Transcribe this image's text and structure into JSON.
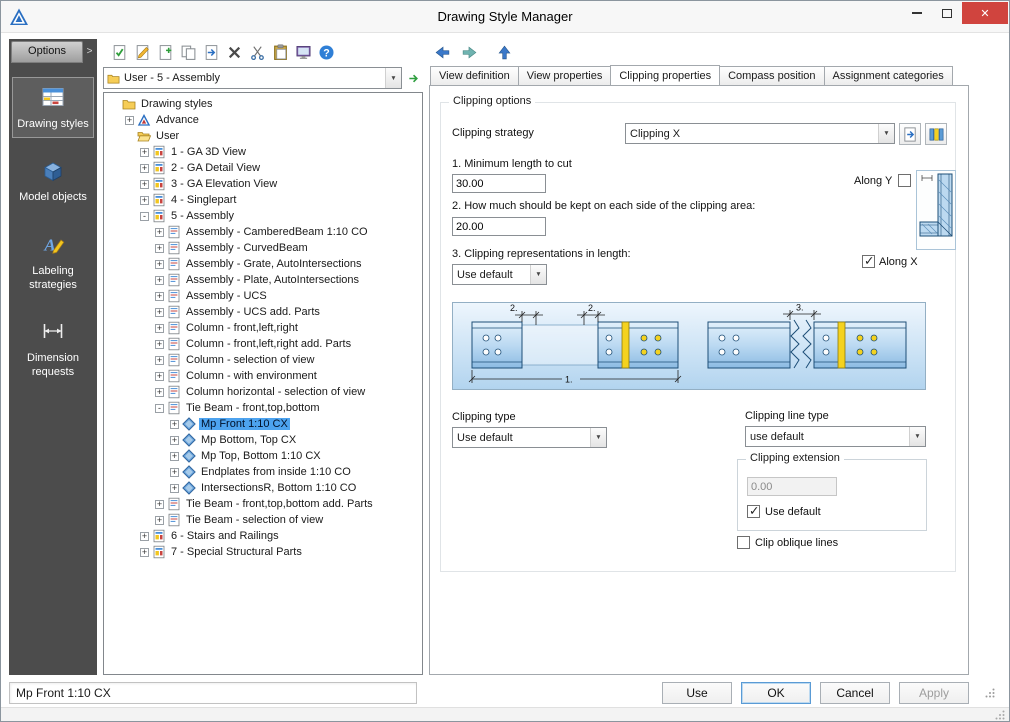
{
  "window": {
    "title": "Drawing Style Manager",
    "icons": [
      "app-logo-icon",
      "minimize-icon",
      "maximize-icon",
      "close-icon"
    ]
  },
  "sidebar": {
    "header_label": "Options",
    "collapse_glyph": ">",
    "items": [
      {
        "label": "Drawing styles",
        "icon": "drawing-styles-icon",
        "selected": true
      },
      {
        "label": "Model objects",
        "icon": "model-objects-icon",
        "selected": false
      },
      {
        "label": "Labeling strategies",
        "icon": "labeling-strategies-icon",
        "selected": false
      },
      {
        "label": "Dimension requests",
        "icon": "dimension-requests-icon",
        "selected": false
      }
    ]
  },
  "toolbar": {
    "icons": [
      "validate-style-icon",
      "edit-style-icon",
      "new-style-icon",
      "copy-style-icon",
      "import-style-icon",
      "delete-style-icon",
      "cut-style-icon",
      "paste-style-icon",
      "display-options-icon",
      "help-icon"
    ],
    "nav_icons": [
      "back-icon",
      "forward-icon",
      "up-icon"
    ]
  },
  "style_selector": {
    "value": "User - 5 - Assembly"
  },
  "tree": {
    "items": [
      {
        "label": "Drawing styles",
        "level": 0,
        "icon": "folder-icon",
        "expander": "",
        "selected": false
      },
      {
        "label": "Advance",
        "level": 1,
        "icon": "advance-logo-icon",
        "expander": "+",
        "selected": false
      },
      {
        "label": "User",
        "level": 1,
        "icon": "open-folder-icon",
        "expander": "",
        "selected": false
      },
      {
        "label": "1 - GA 3D View",
        "level": 2,
        "icon": "style-group-icon",
        "expander": "+",
        "selected": false
      },
      {
        "label": "2 - GA Detail View",
        "level": 2,
        "icon": "style-group-icon",
        "expander": "+",
        "selected": false
      },
      {
        "label": "3 - GA Elevation View",
        "level": 2,
        "icon": "style-group-icon",
        "expander": "+",
        "selected": false
      },
      {
        "label": "4 - Singlepart",
        "level": 2,
        "icon": "style-group-icon",
        "expander": "+",
        "selected": false
      },
      {
        "label": "5 - Assembly",
        "level": 2,
        "icon": "style-group-icon",
        "expander": "-",
        "selected": false
      },
      {
        "label": "Assembly - CamberedBeam 1:10 CO",
        "level": 3,
        "icon": "style-sheet-icon",
        "expander": "+",
        "selected": false
      },
      {
        "label": "Assembly - CurvedBeam",
        "level": 3,
        "icon": "style-sheet-icon",
        "expander": "+",
        "selected": false
      },
      {
        "label": "Assembly - Grate, AutoIntersections",
        "level": 3,
        "icon": "style-sheet-icon",
        "expander": "+",
        "selected": false
      },
      {
        "label": "Assembly - Plate, AutoIntersections",
        "level": 3,
        "icon": "style-sheet-icon",
        "expander": "+",
        "selected": false
      },
      {
        "label": "Assembly - UCS",
        "level": 3,
        "icon": "style-sheet-icon",
        "expander": "+",
        "selected": false
      },
      {
        "label": "Assembly - UCS add. Parts",
        "level": 3,
        "icon": "style-sheet-icon",
        "expander": "+",
        "selected": false
      },
      {
        "label": "Column - front,left,right",
        "level": 3,
        "icon": "style-sheet-icon",
        "expander": "+",
        "selected": false
      },
      {
        "label": "Column - front,left,right add. Parts",
        "level": 3,
        "icon": "style-sheet-icon",
        "expander": "+",
        "selected": false
      },
      {
        "label": "Column - selection of view",
        "level": 3,
        "icon": "style-sheet-icon",
        "expander": "+",
        "selected": false
      },
      {
        "label": "Column - with environment",
        "level": 3,
        "icon": "style-sheet-icon",
        "expander": "+",
        "selected": false
      },
      {
        "label": "Column horizontal - selection of view",
        "level": 3,
        "icon": "style-sheet-icon",
        "expander": "+",
        "selected": false
      },
      {
        "label": "Tie Beam - front,top,bottom",
        "level": 3,
        "icon": "style-sheet-icon",
        "expander": "-",
        "selected": false
      },
      {
        "label": "Mp Front 1:10 CX",
        "level": 4,
        "icon": "view-icon",
        "expander": "+",
        "selected": true
      },
      {
        "label": "Mp Bottom, Top CX",
        "level": 4,
        "icon": "view-icon",
        "expander": "+",
        "selected": false
      },
      {
        "label": "Mp Top, Bottom 1:10 CX",
        "level": 4,
        "icon": "view-icon",
        "expander": "+",
        "selected": false
      },
      {
        "label": "Endplates from inside 1:10 CO",
        "level": 4,
        "icon": "view-icon",
        "expander": "+",
        "selected": false
      },
      {
        "label": "IntersectionsR, Bottom 1:10 CO",
        "level": 4,
        "icon": "view-icon",
        "expander": "+",
        "selected": false
      },
      {
        "label": "Tie Beam - front,top,bottom add. Parts",
        "level": 3,
        "icon": "style-sheet-icon",
        "expander": "+",
        "selected": false
      },
      {
        "label": "Tie Beam - selection of view",
        "level": 3,
        "icon": "style-sheet-icon",
        "expander": "+",
        "selected": false
      },
      {
        "label": "6 - Stairs and Railings",
        "level": 2,
        "icon": "style-group-icon",
        "expander": "+",
        "selected": false
      },
      {
        "label": "7 - Special Structural Parts",
        "level": 2,
        "icon": "style-group-icon",
        "expander": "+",
        "selected": false
      }
    ]
  },
  "tabs": [
    {
      "label": "View definition",
      "active": false
    },
    {
      "label": "View properties",
      "active": false
    },
    {
      "label": "Clipping properties",
      "active": true
    },
    {
      "label": "Compass position",
      "active": false
    },
    {
      "label": "Assignment categories",
      "active": false
    }
  ],
  "clipping": {
    "group_title": "Clipping options",
    "strategy_label": "Clipping strategy",
    "strategy_value": "Clipping X",
    "min_length_label": "1. Minimum length to cut",
    "min_length_value": "30.00",
    "along_y_label": "Along Y",
    "along_y_checked": false,
    "along_x_label": "Along X",
    "along_x_checked": true,
    "keep_label": "2. How much should be kept on each side of the clipping area:",
    "keep_value": "20.00",
    "repr_label": "3. Clipping representations in length:",
    "repr_value": "Use default",
    "diagram_labels": [
      "2.",
      "2.",
      "1.",
      "3."
    ],
    "type_label": "Clipping type",
    "type_value": "Use default",
    "line_type_label": "Clipping line type",
    "line_type_value": "use default",
    "extension_label": "Clipping extension",
    "extension_value": "0.00",
    "extension_default_label": "Use default",
    "extension_default_checked": true,
    "oblique_label": "Clip oblique lines",
    "oblique_checked": false
  },
  "statusbar": {
    "text": "Mp Front 1:10 CX",
    "buttons": [
      {
        "label": "Use",
        "state": "normal"
      },
      {
        "label": "OK",
        "state": "default"
      },
      {
        "label": "Cancel",
        "state": "normal"
      },
      {
        "label": "Apply",
        "state": "disabled"
      }
    ]
  }
}
